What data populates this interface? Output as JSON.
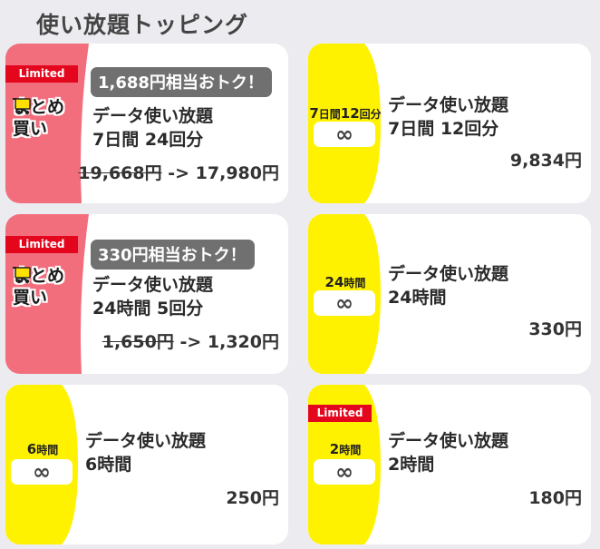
{
  "page": {
    "section_title": "使い放題トッピング"
  },
  "colors": {
    "pink_band": "#f26e7d",
    "yellow_band": "#fff200",
    "limited_red": "#e3061d",
    "pill_gray": "#707070"
  },
  "cards": [
    {
      "limited": "Limited",
      "badge": [
        "まとめ",
        "買い"
      ],
      "deal": "1,688円相当おトク！",
      "title1": "データ使い放題",
      "title2": "7日間 24回分",
      "old_price": "19,668円",
      "arrow": " -> ",
      "price": "17,980円"
    },
    {
      "inf_label_a": "7",
      "inf_label_b": "日間",
      "inf_label_c": "12",
      "inf_label_d": "回分",
      "infinity": "∞",
      "title1": "データ使い放題",
      "title2": "7日間 12回分",
      "price": "9,834円"
    },
    {
      "limited": "Limited",
      "badge": [
        "まとめ",
        "買い"
      ],
      "deal": "330円相当おトク！",
      "title1": "データ使い放題",
      "title2": "24時間 5回分",
      "old_price": "1,650円",
      "arrow": " -> ",
      "price": "1,320円"
    },
    {
      "inf_label_a": "24",
      "inf_label_b": "時間",
      "infinity": "∞",
      "title1": "データ使い放題",
      "title2": "24時間",
      "price": "330円"
    },
    {
      "inf_label_a": "6",
      "inf_label_b": "時間",
      "infinity": "∞",
      "title1": "データ使い放題",
      "title2": "6時間",
      "price": "250円"
    },
    {
      "limited": "Limited",
      "inf_label_a": "2",
      "inf_label_b": "時間",
      "infinity": "∞",
      "title1": "データ使い放題",
      "title2": "2時間",
      "price": "180円"
    }
  ]
}
